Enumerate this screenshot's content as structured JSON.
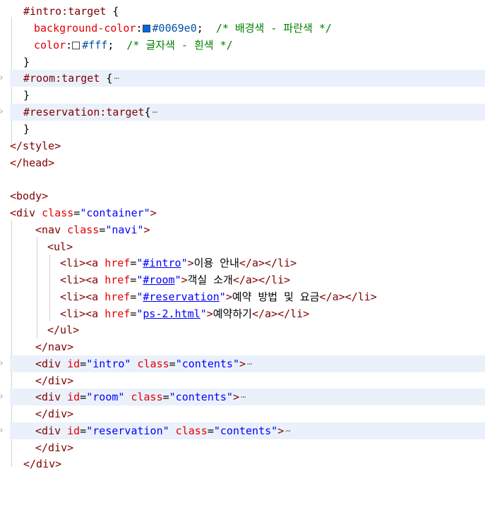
{
  "colors": {
    "blue_swatch": "#0069e0",
    "white_swatch": "#ffffff",
    "highlight": "#eaf1fb"
  },
  "lines": {
    "l1": {
      "sel": "#intro:target",
      "brace": " {"
    },
    "l2": {
      "prop": "background-color",
      "colon": ":",
      "val": "#0069e0",
      "semi": ";",
      "cmt": "  /* 배경색 - 파란색 */"
    },
    "l3": {
      "prop": "color",
      "colon": ":",
      "val": "#fff",
      "semi": ";",
      "cmt": "  /* 글자색 - 흰색 */"
    },
    "l4": {
      "brace": "}"
    },
    "l5": {
      "sel": "#room:target",
      "brace": " {",
      "ellipsis": "⋯"
    },
    "l6": {
      "brace": "}"
    },
    "l7": {
      "sel": "#reservation:target",
      "brace": "{",
      "ellipsis": "⋯"
    },
    "l8": {
      "brace": "}"
    },
    "l9": {
      "tag": "</style>"
    },
    "l10": {
      "tag": "</head>"
    },
    "l12": {
      "tag": "<body>"
    },
    "l13": {
      "open": "<div",
      "attr": " class",
      "eq": "=",
      "str": "\"container\"",
      "close": ">"
    },
    "l14": {
      "open": "<nav",
      "attr": " class",
      "eq": "=",
      "str": "\"navi\"",
      "close": ">"
    },
    "l15": {
      "tag": "<ul>"
    },
    "l16": {
      "li_open": "<li><a",
      "attr": " href",
      "eq": "=",
      "q1": "\"",
      "link": "#intro",
      "q2": "\"",
      "close": ">",
      "text": "이용 안내",
      "end": "</a></li>"
    },
    "l17": {
      "li_open": "<li><a",
      "attr": " href",
      "eq": "=",
      "q1": "\"",
      "link": "#room",
      "q2": "\"",
      "close": ">",
      "text": "객실 소개",
      "end": "</a></li>"
    },
    "l18": {
      "li_open": "<li><a",
      "attr": " href",
      "eq": "=",
      "q1": "\"",
      "link": "#reservation",
      "q2": "\"",
      "close": ">",
      "text": "예약 방법 및 요금",
      "end": "</a></li>"
    },
    "l19": {
      "li_open": "<li><a",
      "attr": " href",
      "eq": "=",
      "q1": "\"",
      "link": "ps-2.html",
      "q2": "\"",
      "close": ">",
      "text": "예약하기",
      "end": "</a></li>"
    },
    "l20": {
      "tag": "</ul>"
    },
    "l21": {
      "tag": "</nav>"
    },
    "l22": {
      "open": "<div",
      "attr1": " id",
      "eq1": "=",
      "str1": "\"intro\"",
      "attr2": " class",
      "eq2": "=",
      "str2": "\"contents\"",
      "close": ">",
      "ellipsis": "⋯"
    },
    "l23": {
      "tag": "</div>"
    },
    "l24": {
      "open": "<div",
      "attr1": " id",
      "eq1": "=",
      "str1": "\"room\"",
      "attr2": " class",
      "eq2": "=",
      "str2": "\"contents\"",
      "close": ">",
      "ellipsis": "⋯"
    },
    "l25": {
      "tag": "</div>"
    },
    "l26": {
      "open": "<div",
      "attr1": " id",
      "eq1": "=",
      "str1": "\"reservation\"",
      "attr2": " class",
      "eq2": "=",
      "str2": "\"contents\"",
      "close": ">",
      "ellipsis": "⋯"
    },
    "l27": {
      "tag": "</div>"
    },
    "l28": {
      "tag": "</div>"
    }
  }
}
